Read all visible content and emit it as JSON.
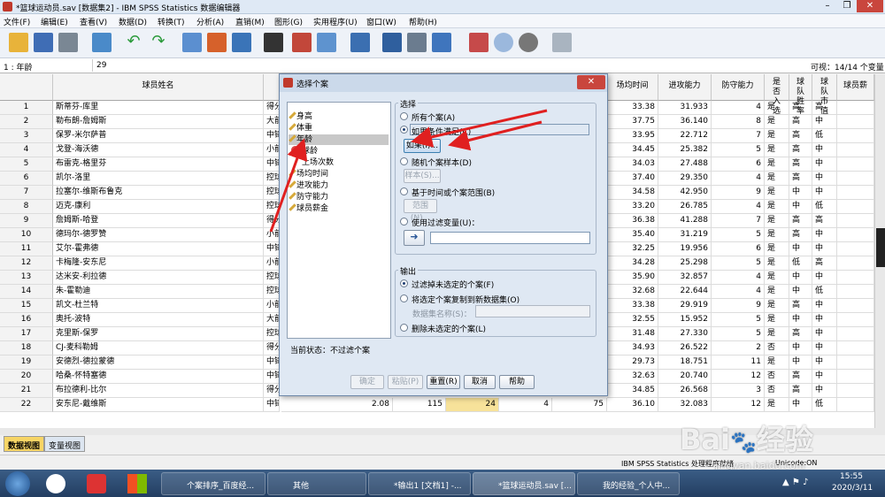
{
  "window": {
    "title": "*篮球运动员.sav [数据集2] - IBM SPSS Statistics 数据编辑器"
  },
  "menu": [
    "文件(F)",
    "编辑(E)",
    "查看(V)",
    "数据(D)",
    "转换(T)",
    "分析(A)",
    "直销(M)",
    "图形(G)",
    "实用程序(U)",
    "窗口(W)",
    "帮助(H)"
  ],
  "cell_editor": {
    "ref": "1 : 年龄",
    "value": "29",
    "visible": "可视：14/14 个变量"
  },
  "columns": {
    "name": "球员姓名",
    "time": "场均时间",
    "attack": "进攻能力",
    "defense": "防守能力",
    "select": "是否入选",
    "rate": "球队胜率",
    "value": "球队市值",
    "last": "球员薪"
  },
  "rows": [
    {
      "n": "1",
      "name": "斯蒂芬-库里",
      "pos": "得分",
      "time": "33.38",
      "attack": "31.933",
      "def": "4",
      "sel": "是",
      "rate": "高",
      "val": "高"
    },
    {
      "n": "2",
      "name": "勒布朗-詹姆斯",
      "pos": "大前",
      "time": "37.75",
      "attack": "36.140",
      "def": "8",
      "sel": "是",
      "rate": "高",
      "val": "中"
    },
    {
      "n": "3",
      "name": "保罗-米尔萨普",
      "pos": "中锋",
      "time": "33.95",
      "attack": "22.712",
      "def": "7",
      "sel": "是",
      "rate": "高",
      "val": "低"
    },
    {
      "n": "4",
      "name": "戈登-海沃德",
      "pos": "小前",
      "time": "34.45",
      "attack": "25.382",
      "def": "5",
      "sel": "是",
      "rate": "高",
      "val": "中"
    },
    {
      "n": "5",
      "name": "布雷克-格里芬",
      "pos": "中锋",
      "time": "34.03",
      "attack": "27.488",
      "def": "6",
      "sel": "是",
      "rate": "高",
      "val": "中"
    },
    {
      "n": "6",
      "name": "凯尔-洛里",
      "pos": "控球",
      "time": "37.40",
      "attack": "29.350",
      "def": "4",
      "sel": "是",
      "rate": "高",
      "val": "中"
    },
    {
      "n": "7",
      "name": "拉塞尔-维斯布鲁克",
      "pos": "控球",
      "time": "34.58",
      "attack": "42.950",
      "def": "9",
      "sel": "是",
      "rate": "中",
      "val": "中"
    },
    {
      "n": "8",
      "name": "迈克-康利",
      "pos": "控球",
      "time": "33.20",
      "attack": "26.785",
      "def": "4",
      "sel": "是",
      "rate": "中",
      "val": "低"
    },
    {
      "n": "9",
      "name": "詹姆斯-哈登",
      "pos": "得分",
      "time": "36.38",
      "attack": "41.288",
      "def": "7",
      "sel": "是",
      "rate": "高",
      "val": "高"
    },
    {
      "n": "10",
      "name": "德玛尔-德罗赞",
      "pos": "小前",
      "time": "35.40",
      "attack": "31.219",
      "def": "5",
      "sel": "是",
      "rate": "高",
      "val": "中"
    },
    {
      "n": "11",
      "name": "艾尔-霍弗德",
      "pos": "中锋",
      "time": "32.25",
      "attack": "19.956",
      "def": "6",
      "sel": "是",
      "rate": "中",
      "val": "中"
    },
    {
      "n": "12",
      "name": "卡梅隆-安东尼",
      "pos": "小前",
      "time": "34.28",
      "attack": "25.298",
      "def": "5",
      "sel": "是",
      "rate": "低",
      "val": "高"
    },
    {
      "n": "13",
      "name": "达米安-利拉德",
      "pos": "控球",
      "time": "35.90",
      "attack": "32.857",
      "def": "4",
      "sel": "是",
      "rate": "中",
      "val": "中"
    },
    {
      "n": "14",
      "name": "朱-霍勒迪",
      "pos": "控球",
      "time": "32.68",
      "attack": "22.644",
      "def": "4",
      "sel": "是",
      "rate": "中",
      "val": "低"
    },
    {
      "n": "15",
      "name": "凯文-杜兰特",
      "pos": "小前",
      "time": "33.38",
      "attack": "29.919",
      "def": "9",
      "sel": "是",
      "rate": "高",
      "val": "中"
    },
    {
      "n": "16",
      "name": "奥托-波特",
      "pos": "大前",
      "time": "32.55",
      "attack": "15.952",
      "def": "5",
      "sel": "是",
      "rate": "中",
      "val": "中"
    },
    {
      "n": "17",
      "name": "克里斯-保罗",
      "pos": "控球",
      "time": "31.48",
      "attack": "27.330",
      "def": "5",
      "sel": "是",
      "rate": "高",
      "val": "中"
    },
    {
      "n": "18",
      "name": "CJ-麦科勒姆",
      "pos": "得分",
      "time": "34.93",
      "attack": "26.522",
      "def": "2",
      "sel": "否",
      "rate": "中",
      "val": "中"
    },
    {
      "n": "19",
      "name": "安德烈-德拉蒙德",
      "pos": "中锋",
      "time": "29.73",
      "attack": "18.751",
      "def": "11",
      "sel": "是",
      "rate": "中",
      "val": "中"
    },
    {
      "n": "20",
      "name": "哈桑-怀特塞德",
      "pos": "中锋",
      "time": "32.63",
      "attack": "20.740",
      "def": "12",
      "sel": "否",
      "rate": "高",
      "val": "中"
    },
    {
      "n": "21",
      "name": "布拉德利-比尔",
      "pos": "得分",
      "time": "34.85",
      "attack": "26.568",
      "def": "3",
      "sel": "否",
      "rate": "高",
      "val": "中"
    },
    {
      "n": "22",
      "name": "安东尼-戴维斯",
      "pos": "中锋",
      "time": "36.10",
      "attack": "32.083",
      "def": "12",
      "sel": "是",
      "rate": "中",
      "val": "低"
    }
  ],
  "row22_extra": {
    "a": "2.08",
    "b": "115",
    "c": "24",
    "d": "4",
    "e": "75"
  },
  "tabs": {
    "data_view": "数据视图",
    "var_view": "变量视图"
  },
  "status": {
    "processor": "IBM SPSS Statistics 处理程序就绪",
    "unicode": "Unicode:ON"
  },
  "dialog": {
    "title": "选择个案",
    "vars": [
      "身高",
      "体重",
      "年龄",
      "球龄",
      "上场次数",
      "场均时间",
      "进攻能力",
      "防守能力",
      "球员薪金"
    ],
    "current_status": "当前状态：不过滤个案",
    "select_label": "选择",
    "opt_all": "所有个案(A)",
    "opt_if": "如果条件满足(C)",
    "btn_if": "如果(I)...",
    "opt_random": "随机个案样本(D)",
    "btn_sample": "样本(S)...",
    "opt_range": "基于时间或个案范围(B)",
    "btn_range": "范围(N)...",
    "opt_filter": "使用过滤变量(U)：",
    "output_label": "输出",
    "out_filter": "过滤掉未选定的个案(F)",
    "out_copy": "将选定个案复制到新数据集(O)",
    "dataset_name": "数据集名称(S)：",
    "out_delete": "删除未选定的个案(L)",
    "buttons": {
      "ok": "确定",
      "paste": "粘贴(P)",
      "reset": "重置(R)",
      "cancel": "取消",
      "help": "帮助"
    }
  },
  "taskbar": {
    "items": [
      "个案排序_百度经...",
      "其他",
      "*输出1 [文档1] -...",
      "*篮球运动员.sav [...",
      "我的经验_个人中..."
    ],
    "time": "15:55",
    "date": "2020/3/11"
  },
  "watermark": {
    "brand": "Bai",
    "brand2": "经验",
    "url": "jingyan.baidu.com"
  },
  "colors": {
    "accent": "#2b5797",
    "highlight": "#f7e29a",
    "arrow": "#e02020"
  }
}
